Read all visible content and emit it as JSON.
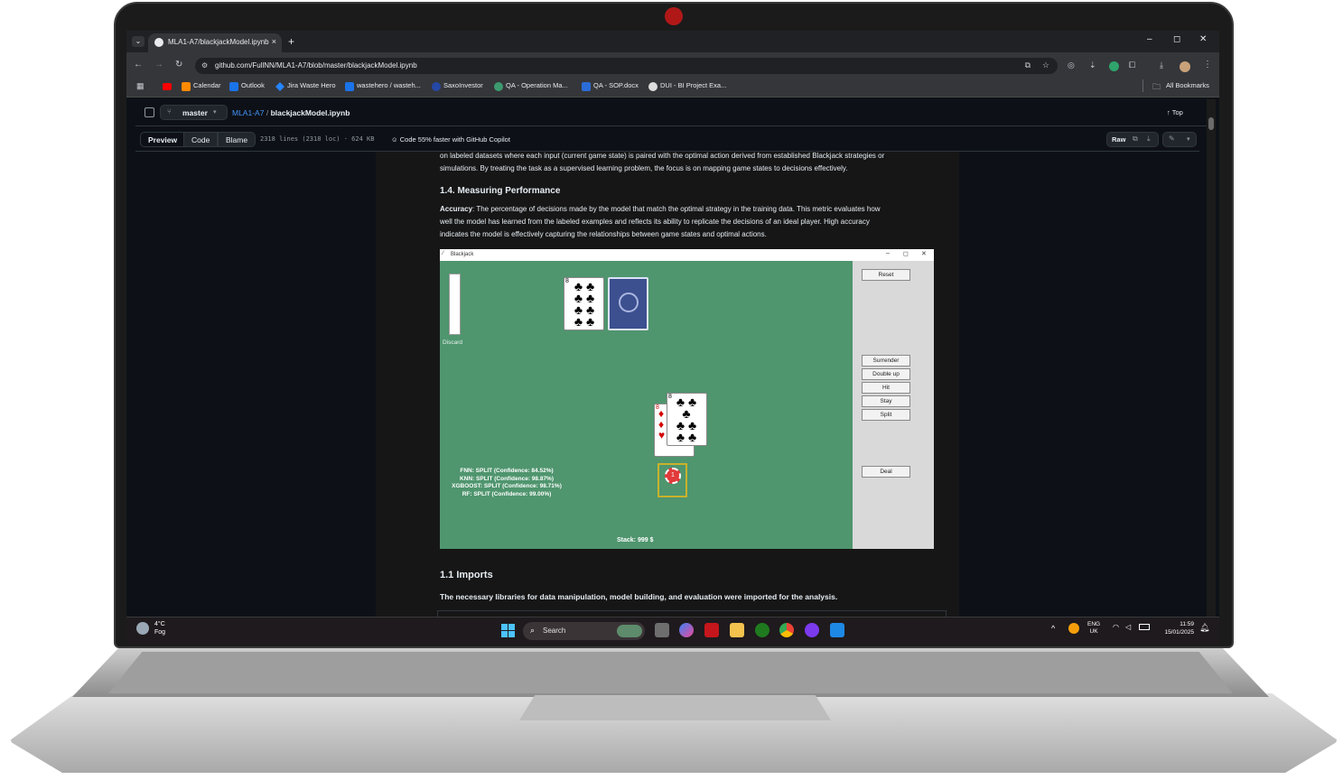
{
  "browser": {
    "tab_title": "MLA1-A7/blackjackModel.ipynb",
    "tab_close": "×",
    "new_tab": "+",
    "url": "github.com/FullNN/MLA1-A7/blob/master/blackjackModel.ipynb",
    "window_minimize": "–",
    "window_maximize": "◻",
    "window_close": "✕",
    "bookmarks": [
      "Calendar",
      "Outlook",
      "Jira Waste Hero",
      "wastehero / wasteh...",
      "SaxoInvestor",
      "QA - Operation Ma...",
      "QA - SOP.docx",
      "DUI - BI Project Exa..."
    ],
    "all_bookmarks": "All Bookmarks"
  },
  "github": {
    "branch": "master",
    "repo": "MLA1-A7",
    "separator": "/",
    "file": "blackjackModel.ipynb",
    "top_label": "Top",
    "view_tabs": [
      "Preview",
      "Code",
      "Blame"
    ],
    "file_meta": "2318 lines (2318 loc) · 624 KB",
    "copilot": "Code 55% faster with GitHub Copilot",
    "raw_label": "Raw"
  },
  "notebook": {
    "intro_line1": "on labeled datasets where each input (current game state) is paired with the optimal action derived from established Blackjack strategies or",
    "intro_line2": "simulations. By treating the task as a supervised learning problem, the focus is on mapping game states to decisions effectively.",
    "heading_measuring": "1.4. Measuring Performance",
    "accuracy_label": "Accuracy",
    "accuracy_line1": ": The percentage of decisions made by the model that match the optimal strategy in the training data. This metric evaluates how",
    "accuracy_line2": "well the model has learned from the labeled examples and reflects its ability to replicate the decisions of an ideal player. High accuracy",
    "accuracy_line3": "indicates the model is effectively capturing the relationships between game states and optimal actions.",
    "heading_imports": "1.1 Imports",
    "imports_text": "The necessary libraries for data manipulation, model building, and evaluation were imported for the analysis."
  },
  "game": {
    "window_title": "Blackjack",
    "discard_label": "Discard",
    "buttons": {
      "reset": "Reset",
      "surrender": "Surrender",
      "double_up": "Double up",
      "hit": "Hit",
      "stay": "Stay",
      "split": "Split",
      "deal": "Deal"
    },
    "predictions": [
      "FNN: SPLIT (Confidence: 84.52%)",
      "KNN: SPLIT (Confidence: 98.87%)",
      "XGBOOST: SPLIT (Confidence: 98.71%)",
      "RF: SPLIT (Confidence: 99.00%)"
    ],
    "stack": "Stack: 999 $",
    "chip_value": "1",
    "dealer_card_rank": "8",
    "player_card1_rank": "8",
    "player_card2_rank": "8"
  },
  "taskbar": {
    "weather_temp": "4°C",
    "weather_desc": "Fog",
    "search_placeholder": "Search",
    "language_top": "ENG",
    "language_bottom": "UK",
    "time": "11:59",
    "date": "15/01/2025"
  },
  "colors": {
    "felt": "#4f956e",
    "card_back": "#3c4f8f",
    "github_bg": "#0d1117",
    "accent_link": "#4493f8",
    "lid_camera": "#b01818"
  }
}
